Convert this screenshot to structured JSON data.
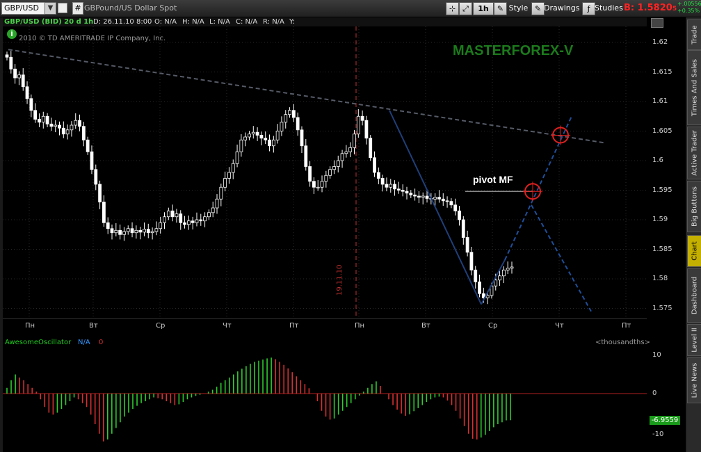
{
  "toolbar": {
    "symbol": "GBP/USD",
    "description": "GBPound/US Dollar Spot",
    "hash": "#",
    "interval": "1h",
    "style_label": "Style",
    "drawings_label": "Drawings",
    "studies_label": "Studies",
    "bid_label": "B:",
    "bid_value": "1.5820",
    "bid_suffix": "5",
    "change_abs": "+.00556",
    "change_pct": "+0.35%"
  },
  "chart_header": {
    "instrument": "GBP/USD (BID) 20 d 1h",
    "date": "D: 26.11.10 8:00",
    "open": "O: N/A",
    "high": "H: N/A",
    "low": "L: N/A",
    "close": "C: N/A",
    "range": "R: N/A",
    "y": "Y:",
    "copyright": "2010 © TD AMERITRADE IP Company, Inc.",
    "info_icon": "i"
  },
  "watermark": "MASTERFOREX-V",
  "annotation": "pivot MF",
  "vline_label": "19.11.10",
  "y_axis": [
    "1.62",
    "1.615",
    "1.61",
    "1.605",
    "1.6",
    "1.595",
    "1.59",
    "1.585",
    "1.58",
    "1.575"
  ],
  "x_axis": [
    "Пн",
    "Вт",
    "Ср",
    "Чт",
    "Пт",
    "Пн",
    "Вт",
    "Ср",
    "Чт",
    "Пт"
  ],
  "oscillator": {
    "name": "AwesomeOscillator",
    "na": "N/A",
    "zero": "0",
    "units": "<thousandths>",
    "value": "-6.9559",
    "y_axis": [
      "10",
      "0",
      "-10"
    ]
  },
  "side_tabs": [
    "Trade",
    "Times And Sales",
    "Active Trader",
    "Big Buttons",
    "Chart",
    "Dashboard",
    "Level II",
    "Live News"
  ],
  "colors": {
    "bull": "#ffffff",
    "bear": "#ffffff",
    "osc_up": "#2ecc2e",
    "osc_down": "#d83030",
    "trend": "#1f3f7a",
    "watermark": "#1c7a1c"
  },
  "chart_data": {
    "type": "candlestick",
    "ylim": [
      1.574,
      1.622
    ],
    "closes": [
      1.6175,
      1.6155,
      1.614,
      1.6145,
      1.6125,
      1.6105,
      1.6085,
      1.607,
      1.6065,
      1.6075,
      1.6062,
      1.6058,
      1.606,
      1.6055,
      1.6045,
      1.6052,
      1.606,
      1.6068,
      1.6058,
      1.6035,
      1.6015,
      1.5985,
      1.596,
      1.593,
      1.5895,
      1.5885,
      1.5878,
      1.5882,
      1.5875,
      1.588,
      1.5885,
      1.5878,
      1.5882,
      1.5879,
      1.5884,
      1.5878,
      1.588,
      1.5885,
      1.5895,
      1.5905,
      1.5915,
      1.5905,
      1.591,
      1.5895,
      1.5892,
      1.5898,
      1.5895,
      1.59,
      1.5898,
      1.5905,
      1.5912,
      1.592,
      1.5935,
      1.5955,
      1.597,
      1.598,
      1.5995,
      1.6015,
      1.6035,
      1.604,
      1.6045,
      1.6048,
      1.6043,
      1.6038,
      1.6035,
      1.6025,
      1.6035,
      1.605,
      1.6065,
      1.6078,
      1.6085,
      1.6073,
      1.6052,
      1.6025,
      1.599,
      1.5965,
      1.5955,
      1.5955,
      1.5965,
      1.5975,
      1.5985,
      1.599,
      1.6,
      1.6012,
      1.6015,
      1.6022,
      1.6045,
      1.6075,
      1.6068,
      1.6038,
      1.6005,
      1.598,
      1.597,
      1.596,
      1.5955,
      1.596,
      1.5952,
      1.595,
      1.5948,
      1.5945,
      1.5942,
      1.594,
      1.5938,
      1.594,
      1.5936,
      1.5935,
      1.5938,
      1.5935,
      1.5932,
      1.5931,
      1.5925,
      1.5915,
      1.59,
      1.587,
      1.5845,
      1.5815,
      1.5795,
      1.5775,
      1.5768,
      1.5772,
      1.5788,
      1.5798,
      1.5805,
      1.5815,
      1.5818,
      1.582
    ],
    "oscillator_values": [
      1.5,
      3.5,
      5,
      4.2,
      3.5,
      2.5,
      1.5,
      0.5,
      -1.5,
      -3.5,
      -5,
      -5.5,
      -5,
      -4,
      -3,
      -2,
      -1,
      -1.5,
      -2.5,
      -3.5,
      -5.5,
      -8,
      -10.5,
      -12.5,
      -12,
      -10.5,
      -9,
      -7.5,
      -6,
      -5,
      -4,
      -3.2,
      -2.5,
      -2,
      -1.5,
      -1,
      -1.2,
      -1.5,
      -2,
      -2.5,
      -3,
      -2.8,
      -2.2,
      -1.5,
      -1,
      -0.6,
      -0.3,
      0,
      0.5,
      1,
      1.8,
      2.8,
      3.5,
      4.2,
      5,
      5.8,
      6.5,
      7.2,
      7.8,
      8.3,
      8.6,
      8.9,
      9.2,
      9.4,
      9,
      8.3,
      7.5,
      6.6,
      5.6,
      4.5,
      3.5,
      2.5,
      1.4,
      0,
      -2,
      -4.5,
      -6,
      -6.8,
      -6.5,
      -5.5,
      -4.5,
      -3.5,
      -2.5,
      -1.5,
      -0.5,
      0.5,
      1.5,
      2.5,
      3.2,
      2,
      0,
      -1.5,
      -3,
      -4.2,
      -5.2,
      -5.8,
      -5.4,
      -4.6,
      -3.8,
      -3,
      -2.2,
      -1.5,
      -1,
      -0.8,
      -1,
      -1.8,
      -3,
      -4.5,
      -6.5,
      -8.5,
      -10.5,
      -11.8,
      -12,
      -11.5,
      -10.8,
      -9.8,
      -8.8,
      -8,
      -7.5,
      -7,
      -6.9559
    ]
  }
}
